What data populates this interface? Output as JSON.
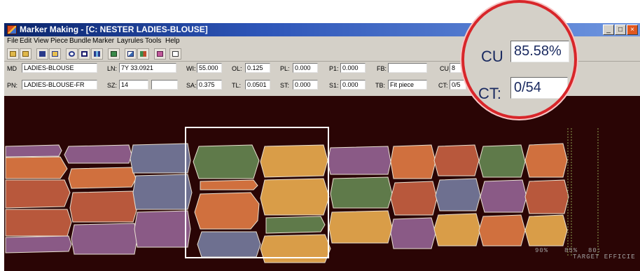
{
  "window": {
    "title": "Marker Making - [C:  NESTER  LADIES-BLOUSE]",
    "controls": [
      "_",
      "□",
      "×"
    ]
  },
  "menu": [
    "File",
    "Edit",
    "View",
    "Piece",
    "Bundle",
    "Marker",
    "Layrules",
    "Tools",
    "Help"
  ],
  "toolbar_icons": [
    "open-folder-icon",
    "save-folder-icon",
    "save-disk-icon",
    "copy-icon",
    "zoom-icon",
    "rectangle-icon",
    "grid-icon",
    "layout-icon",
    "move-icon",
    "pieces-icon",
    "bundle-icon",
    "marker-icon"
  ],
  "fields": {
    "md_label": "MD",
    "md_value": "LADIES-BLOUSE",
    "pn_label": "PN:",
    "pn_value": "LADIES-BLOUSE-FR",
    "ln_label": "LN:",
    "ln_value": "7Y 33.0921",
    "sz_label": "SZ:",
    "sz_value": "14",
    "wi_label": "WI:",
    "wi_value": "55.000",
    "sa_label": "SA:",
    "sa_value": "0.375",
    "ol_label": "OL:",
    "ol_value": "0.125",
    "tl_label": "TL:",
    "tl_value": "0.0501",
    "pl_label": "PL:",
    "pl_value": "0.000",
    "st_label": "ST:",
    "st_value": "0.000",
    "p1_label": "P1:",
    "p1_value": "0.000",
    "s1_label": "S1:",
    "s1_value": "0.000",
    "fb_label": "FB:",
    "tb_label": "TB:",
    "tb_value": "Fit piece",
    "cu_label": "CU",
    "cu_value_partial": "8",
    "ct_label": "CT:",
    "ct_value_partial": "0/5"
  },
  "zoom": {
    "cu_label": "CU",
    "cu_value": "85.58%",
    "ct_label": "CT:",
    "ct_value": "0/54"
  },
  "scale": {
    "tick_90": "90%",
    "tick_85": "85%",
    "tick_80": "80:",
    "target_label": "TARGET EFFICIE"
  },
  "colors": {
    "green": "#5f7a4a",
    "orange": "#d0703e",
    "yellow": "#d99d48",
    "purple": "#8a5a86",
    "slate": "#6e7090",
    "rust": "#b8583c",
    "background": "#2a0505",
    "highlight_circle": "#d8262a"
  }
}
